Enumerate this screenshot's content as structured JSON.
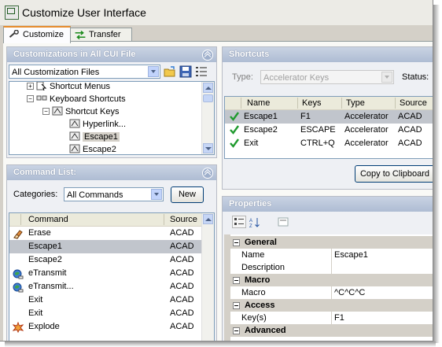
{
  "window": {
    "title": "Customize User Interface"
  },
  "tabs": [
    {
      "label": "Customize",
      "active": true
    },
    {
      "label": "Transfer",
      "active": false
    }
  ],
  "customizations": {
    "header": "Customizations in All CUI File",
    "file_dropdown": "All Customization Files",
    "tree": [
      {
        "label": "Shortcut Menus",
        "indent": 1,
        "expander": "+",
        "icon": "shortcut-menus-icon"
      },
      {
        "label": "Keyboard Shortcuts",
        "indent": 1,
        "expander": "-",
        "icon": "keyboard-shortcuts-icon"
      },
      {
        "label": "Shortcut Keys",
        "indent": 2,
        "expander": "-",
        "icon": "shortcut-keys-icon"
      },
      {
        "label": "Hyperlink...",
        "indent": 3,
        "expander": "",
        "icon": "key-icon"
      },
      {
        "label": "Escape1",
        "indent": 3,
        "expander": "",
        "icon": "key-icon",
        "selected": true
      },
      {
        "label": "Escape2",
        "indent": 3,
        "expander": "",
        "icon": "key-icon"
      }
    ]
  },
  "command_list": {
    "header": "Command List:",
    "categories_label": "Categories:",
    "categories_value": "All Commands",
    "new_button": "New",
    "columns": [
      "Command",
      "Source"
    ],
    "rows": [
      {
        "command": "Erase",
        "source": "ACAD",
        "icon": "eraser-icon"
      },
      {
        "command": "Escape1",
        "source": "ACAD",
        "icon": "",
        "selected": true
      },
      {
        "command": "Escape2",
        "source": "ACAD",
        "icon": ""
      },
      {
        "command": "eTransmit",
        "source": "ACAD",
        "icon": "etransmit-icon"
      },
      {
        "command": "eTransmit...",
        "source": "ACAD",
        "icon": "etransmit-icon"
      },
      {
        "command": "Exit",
        "source": "ACAD",
        "icon": ""
      },
      {
        "command": "Exit",
        "source": "ACAD",
        "icon": ""
      },
      {
        "command": "Explode",
        "source": "ACAD",
        "icon": "explode-icon"
      }
    ]
  },
  "shortcuts": {
    "header": "Shortcuts",
    "type_label": "Type:",
    "type_value": "Accelerator Keys",
    "status_label": "Status:",
    "columns": [
      "Name",
      "Keys",
      "Type",
      "Source"
    ],
    "rows": [
      {
        "name": "Escape1",
        "keys": "F1",
        "type": "Accelerator",
        "source": "ACAD"
      },
      {
        "name": "Escape2",
        "keys": "ESCAPE",
        "type": "Accelerator",
        "source": "ACAD"
      },
      {
        "name": "Exit",
        "keys": "CTRL+Q",
        "type": "Accelerator",
        "source": "ACAD"
      }
    ],
    "copy_button": "Copy to Clipboard"
  },
  "properties": {
    "header": "Properties",
    "sections": [
      {
        "name": "General",
        "rows": [
          {
            "key": "Name",
            "value": "Escape1"
          },
          {
            "key": "Description",
            "value": ""
          }
        ]
      },
      {
        "name": "Macro",
        "rows": [
          {
            "key": "Macro",
            "value": "^C^C^C"
          }
        ]
      },
      {
        "name": "Access",
        "rows": [
          {
            "key": "Key(s)",
            "value": "F1"
          }
        ]
      },
      {
        "name": "Advanced",
        "rows": []
      }
    ]
  },
  "colors": {
    "accent_tab": "#e68b2c",
    "panel_header": "#aebcd3",
    "selection": "#c1c5cc",
    "check": "#1f9a2e"
  }
}
